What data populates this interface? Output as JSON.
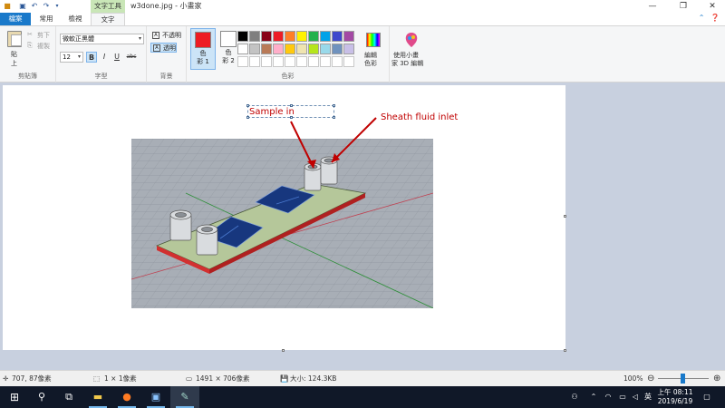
{
  "window": {
    "title": "w3done.jpg - 小畫家",
    "context_tab_label": "文字工具",
    "controls": {
      "minimize": "—",
      "maximize": "❐",
      "close": "✕"
    }
  },
  "quick_access": {
    "icons": [
      "save-icon",
      "undo-icon",
      "redo-icon",
      "customize-dropdown-icon"
    ]
  },
  "tabs": [
    {
      "label": "檔案"
    },
    {
      "label": "常用"
    },
    {
      "label": "檢視"
    },
    {
      "label": "文字"
    }
  ],
  "ribbon": {
    "clipboard": {
      "group_label": "剪貼簿",
      "paste_label_1": "貼",
      "paste_label_2": "上",
      "cut_label": "剪下",
      "copy_label": "複製"
    },
    "font": {
      "group_label": "字型",
      "family": "微軟正黑體",
      "size": "12",
      "bold": "B",
      "italic": "I",
      "underline": "U",
      "strike": "abc"
    },
    "background": {
      "group_label": "背景",
      "opaque_label": "不透明",
      "transparent_label": "透明"
    },
    "colors": {
      "group_label": "色彩",
      "color1_label_1": "色",
      "color1_label_2": "彩 1",
      "color1": "#ed1c24",
      "color2_label_1": "色",
      "color2_label_2": "彩 2",
      "color2": "#ffffff",
      "palette_row1": [
        "#000000",
        "#7f7f7f",
        "#880015",
        "#ed1c24",
        "#ff7f27",
        "#fff200",
        "#22b14c",
        "#00a2e8",
        "#3f48cc",
        "#a349a4"
      ],
      "palette_row2": [
        "#ffffff",
        "#c3c3c3",
        "#b97a57",
        "#ffaec9",
        "#ffc90e",
        "#efe4b0",
        "#b5e61d",
        "#99d9ea",
        "#7092be",
        "#c8bfe7"
      ],
      "edit_label_1": "編輯",
      "edit_label_2": "色彩"
    },
    "paint3d": {
      "label_1": "使用小畫",
      "label_2": "家 3D 編輯"
    }
  },
  "canvas": {
    "annotation_sample": "Sample in",
    "annotation_sheath": "Sheath fluid inlet",
    "annotation_color": "#c00000"
  },
  "statusbar": {
    "cursor_pos": "707, 87像素",
    "selection_size": "1 × 1像素",
    "image_size": "1491 × 706像素",
    "file_size": "大小: 124.3KB",
    "zoom": "100%",
    "zoom_out": "⊖",
    "zoom_in": "⊕"
  },
  "taskbar": {
    "ime_label": "英",
    "time": "上午 08:11",
    "date": "2019/6/19"
  }
}
